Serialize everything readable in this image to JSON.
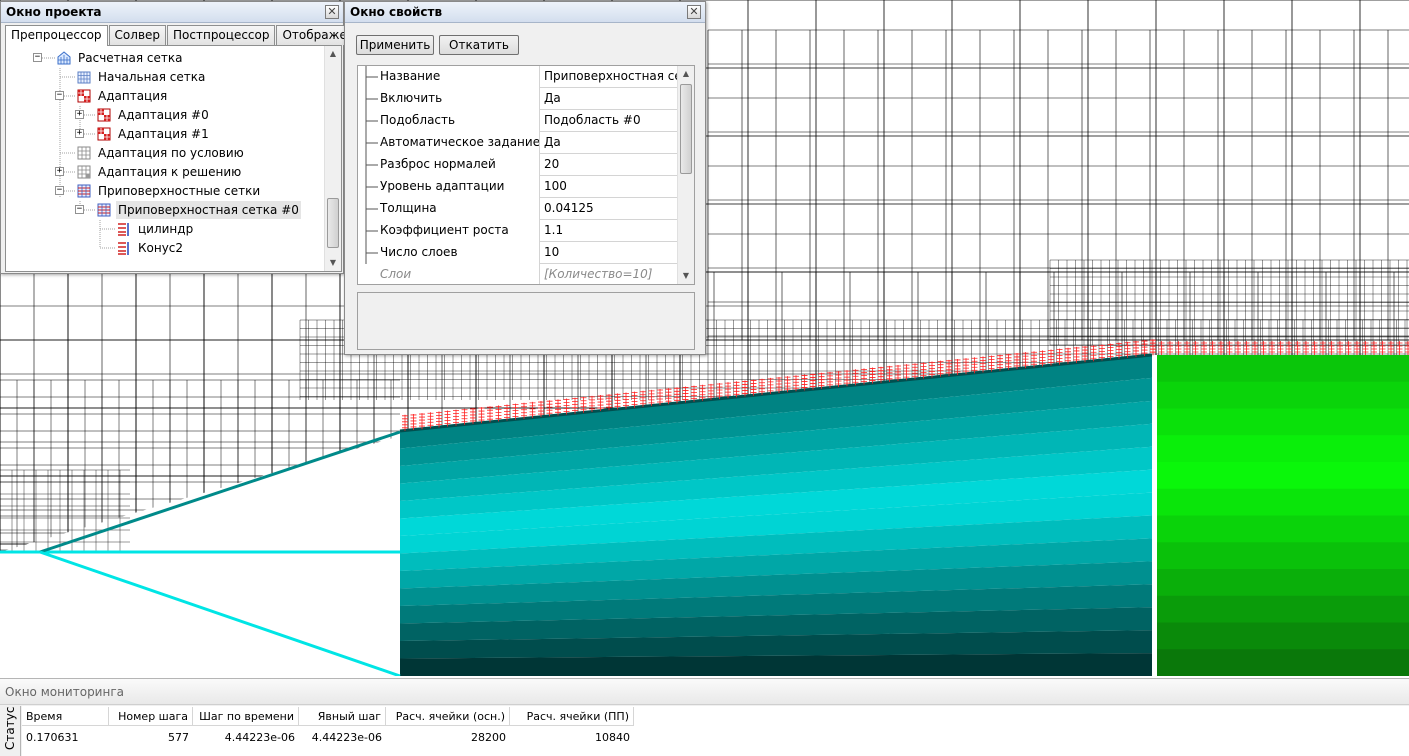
{
  "project_window": {
    "title": "Окно проекта",
    "close_glyph": "✕",
    "tabs": [
      "Препроцессор",
      "Солвер",
      "Постпроцессор",
      "Отображение"
    ],
    "tree": [
      {
        "label": "Расчетная сетка",
        "icon": "mesh-icon"
      },
      {
        "label": "Начальная сетка",
        "icon": "initial-mesh-icon"
      },
      {
        "label": "Адаптация",
        "icon": "adaptation-icon"
      },
      {
        "label": "Адаптация #0",
        "icon": "adaptation-icon"
      },
      {
        "label": "Адаптация #1",
        "icon": "adaptation-icon"
      },
      {
        "label": "Адаптация по условию",
        "icon": "condition-adaptation-icon"
      },
      {
        "label": "Адаптация к решению",
        "icon": "solution-adaptation-icon"
      },
      {
        "label": "Приповерхностные сетки",
        "icon": "surface-mesh-icon"
      },
      {
        "label": "Приповерхностная сетка #0",
        "icon": "surface-mesh-icon"
      },
      {
        "label": "цилиндр",
        "icon": "surface-layer-icon"
      },
      {
        "label": "Конус2",
        "icon": "surface-layer-icon"
      }
    ]
  },
  "properties_window": {
    "title": "Окно свойств",
    "close_glyph": "✕",
    "apply_label": "Применить",
    "rollback_label": "Откатить",
    "rows": [
      {
        "name": "Название",
        "value": "Приповерхностная сет"
      },
      {
        "name": "Включить",
        "value": "Да"
      },
      {
        "name": "Подобласть",
        "value": "Подобласть #0"
      },
      {
        "name": "Автоматическое задание то",
        "value": "Да"
      },
      {
        "name": "Разброс нормалей",
        "value": "20"
      },
      {
        "name": "Уровень адаптации",
        "value": "100"
      },
      {
        "name": "Толщина",
        "value": "0.04125"
      },
      {
        "name": "Коэффициент роста",
        "value": "1.1"
      },
      {
        "name": "Число слоев",
        "value": "10"
      },
      {
        "name": "Слои",
        "value": "[Количество=10]"
      }
    ]
  },
  "monitor": {
    "title": "Окно мониторинга",
    "status_tab": "Статус",
    "columns": [
      "Время",
      "Номер шага",
      "Шаг по времени",
      "Явный шаг",
      "Расч. ячейки (осн.)",
      "Расч. ячейки (ПП)"
    ],
    "row": [
      "0.170631",
      "577",
      "4.44223e-06",
      "4.44223e-06",
      "28200",
      "10840"
    ]
  },
  "colors": {
    "cone_light": "#00e0e0",
    "cone_dark": "#003c3c",
    "cylinder_light": "#14ff14",
    "cylinder_dark": "#007a00",
    "boundary_layer": "#ff2020",
    "mesh_line": "#000000"
  }
}
